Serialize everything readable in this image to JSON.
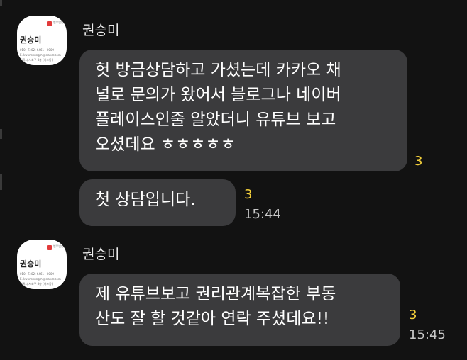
{
  "messages": [
    {
      "sender": "권승미",
      "card_name": "권승미",
      "card_brand": "법무법인",
      "card_lines": [
        "010 · F.(02) 6461 · 0009",
        "E. kwonseungmi@naver.com",
        "서울시 서초구 8층 (서초동)"
      ],
      "bubbles": [
        {
          "lines": [
            "헛 방금상담하고 가셨는데 카카오 채",
            "널로 문의가 왔어서 블로그나 네이버",
            "플레이스인줄 알았더니 유튜브 보고",
            "오셨데요 ㅎㅎㅎㅎㅎ"
          ],
          "unread": "3"
        },
        {
          "lines": [
            "첫 상담입니다."
          ],
          "unread": "3",
          "time": "15:44"
        }
      ]
    },
    {
      "sender": "권승미",
      "card_name": "권승미",
      "card_brand": "법무법인",
      "card_lines": [
        "010 · F.(02) 6461 · 0009",
        "E. kwonseungmi@naver.com",
        "서울시 서초구 8층 (서초동)"
      ],
      "bubbles": [
        {
          "lines": [
            "제 유튜브보고 권리관계복잡한 부동",
            "산도 잘 할 것같아 연락 주셨데요!!"
          ],
          "unread": "3",
          "time": "15:45"
        }
      ]
    }
  ]
}
